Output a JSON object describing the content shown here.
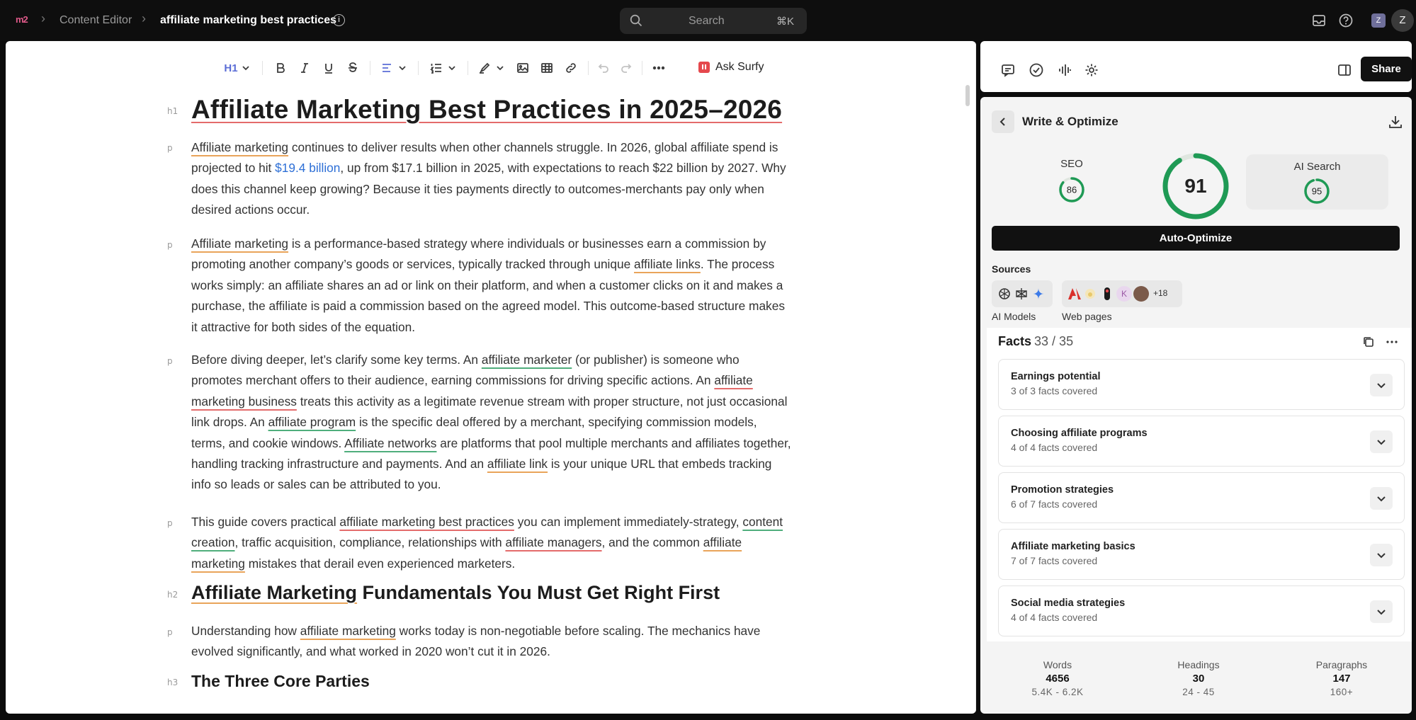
{
  "topbar": {
    "logo": "m2",
    "breadcrumb_app": "Content Editor",
    "breadcrumb_doc": "affiliate marketing best practices",
    "search_placeholder": "Search",
    "search_shortcut": "⌘K",
    "workspace_initial": "Z",
    "avatar_initial": "Z"
  },
  "toolbar": {
    "heading_level": "H1",
    "ask_label": "Ask Surfy"
  },
  "doc": {
    "tags": {
      "h1": "h1",
      "h2": "h2",
      "h3": "h3",
      "p": "p"
    },
    "title": "Affiliate Marketing Best Practices in 2025–2026",
    "p1": {
      "a": "Affiliate marketing",
      "b": " continues to deliver results when other channels struggle. In 2026, global affiliate spend is projected to hit ",
      "c": "$19.4 billion",
      "d": ", up from $17.1 billion in 2025, with expectations to reach $22 billion by 2027. Why does this channel keep growing? Because it ties payments directly to outcomes-merchants pay only when desired actions occur."
    },
    "p2": {
      "a": "Affiliate marketing",
      "b": " is a performance-based strategy where individuals or businesses earn a commission by promoting another company’s goods or services, typically tracked through unique ",
      "c": "affiliate links",
      "d": ". The process works simply: an affiliate shares an ad or link on their platform, and when a customer clicks on it and makes a purchase, the affiliate is paid a commission based on the agreed model. This outcome-based structure makes it attractive for both sides of the equation."
    },
    "p3": {
      "a": "Before diving deeper, let’s clarify some key terms. An ",
      "b": "affiliate marketer",
      "c": " (or publisher) is someone who promotes merchant offers to their audience, earning commissions for driving specific actions. An ",
      "d": "affiliate marketing business",
      "e": " treats this activity as a legitimate revenue stream with proper structure, not just occasional link drops. An ",
      "f": "affiliate program",
      "g": " is the specific deal offered by a merchant, specifying commission models, terms, and cookie windows. ",
      "h": "Affiliate networks",
      "i": " are platforms that pool multiple merchants and affiliates together, handling tracking infrastructure and payments. And an ",
      "j": "affiliate link",
      "k": " is your unique URL that embeds tracking info so leads or sales can be attributed to you."
    },
    "p4": {
      "a": "This guide covers practical ",
      "b": "affiliate marketing best practices",
      "c": " you can implement immediately-strategy, ",
      "d": "content creation",
      "e": ", traffic acquisition, compliance, relationships with ",
      "f": "affiliate managers",
      "g": ", and the common ",
      "h": "affiliate marketing",
      "i": " mistakes that derail even experienced marketers."
    },
    "h2": {
      "a": "Affiliate Marketing",
      "b": " Fundamentals You Must Get Right First"
    },
    "p5": {
      "a": "Understanding how ",
      "b": "affiliate marketing",
      "c": " works today is non-negotiable before scaling. The mechanics have evolved significantly, and what worked in 2020 won’t cut it in 2026."
    },
    "h3": "The Three Core Parties"
  },
  "panel": {
    "share_label": "Share",
    "title": "Write & Optimize",
    "seo_label": "SEO",
    "seo_score": 86,
    "total_score": 91,
    "ai_label": "AI Search",
    "ai_score": 95,
    "auto_optimize": "Auto-Optimize",
    "sources_label": "Sources",
    "sources_more": "+18",
    "ai_models_label": "AI Models",
    "web_pages_label": "Web pages",
    "source_initial": "K",
    "facts_title": "Facts",
    "facts_count": "33 / 35",
    "facts": [
      {
        "title": "Earnings potential",
        "sub": "3 of 3 facts covered"
      },
      {
        "title": "Choosing affiliate programs",
        "sub": "4 of 4 facts covered"
      },
      {
        "title": "Promotion strategies",
        "sub": "6 of 7 facts covered"
      },
      {
        "title": "Affiliate marketing basics",
        "sub": "7 of 7 facts covered"
      },
      {
        "title": "Social media strategies",
        "sub": "4 of 4 facts covered"
      }
    ],
    "stats": [
      {
        "label": "Words",
        "value": "4656",
        "range": "5.4K - 6.2K"
      },
      {
        "label": "Headings",
        "value": "30",
        "range": "24 - 45"
      },
      {
        "label": "Paragraphs",
        "value": "147",
        "range": "160+"
      }
    ]
  },
  "colors": {
    "score_green": "#1f9a55",
    "ring_track": "#dfe6df",
    "underline_red": "#e46b6b",
    "underline_orange": "#e9a45a",
    "underline_green": "#4fae7c",
    "link_blue": "#2d6fd6"
  }
}
